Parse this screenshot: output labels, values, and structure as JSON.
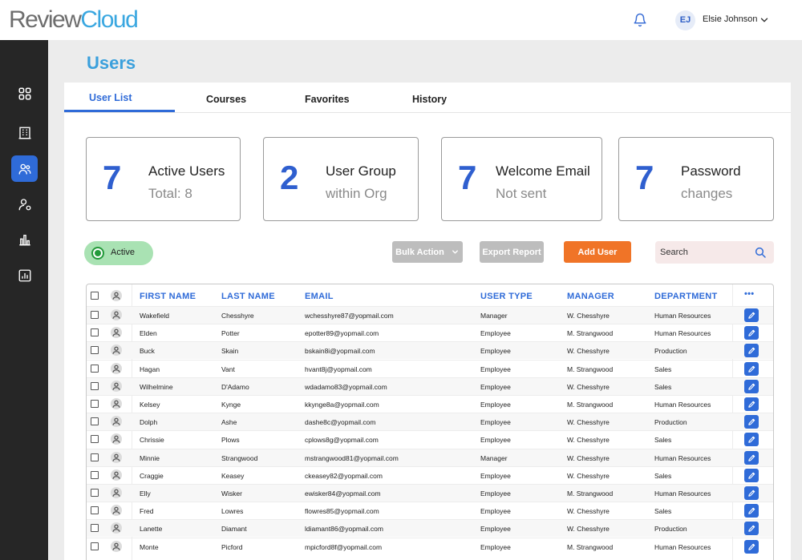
{
  "app": {
    "logo_part1": "Review",
    "logo_part2": "Cloud",
    "user_initials": "EJ",
    "user_name": "Elsie Johnson"
  },
  "colors": {
    "accent": "#2f6bd8",
    "title": "#3ba0dc",
    "add_button": "#f07427",
    "active_green": "#239a3a",
    "sidebar": "#262626"
  },
  "sidebar": {
    "items": [
      {
        "icon": "dashboard-grid-icon",
        "active": false
      },
      {
        "icon": "building-icon",
        "active": false
      },
      {
        "icon": "users-icon",
        "active": true
      },
      {
        "icon": "user-settings-icon",
        "active": false
      },
      {
        "icon": "bar-chart-icon",
        "active": false
      },
      {
        "icon": "report-chart-icon",
        "active": false
      }
    ]
  },
  "page": {
    "title": "Users"
  },
  "tabs": [
    {
      "label": "User List",
      "active": true
    },
    {
      "label": "Courses",
      "active": false
    },
    {
      "label": "Favorites",
      "active": false
    },
    {
      "label": "History",
      "active": false
    }
  ],
  "stats": [
    {
      "number": "7",
      "label": "Active Users",
      "sub": "Total:  8"
    },
    {
      "number": "2",
      "label": "User Group",
      "sub": "within Org"
    },
    {
      "number": "7",
      "label": "Welcome Email",
      "sub": "Not sent"
    },
    {
      "number": "7",
      "label": "Password",
      "sub": "changes"
    }
  ],
  "toolbar": {
    "status_filter": "Active",
    "bulk_action": "Bulk Action",
    "export_report": "Export Report",
    "add_user": "Add User",
    "search_placeholder": "Search"
  },
  "table": {
    "columns": [
      "FIRST NAME",
      "LAST NAME",
      "EMAIL",
      "USER TYPE",
      "MANAGER",
      "DEPARTMENT"
    ],
    "more_label": "•••",
    "rows": [
      {
        "first": "Wakefield",
        "last": "Chesshyre",
        "email": "wchesshyre87@yopmail.com",
        "type": "Manager",
        "manager": "W. Chesshyre",
        "dept": "Human Resources"
      },
      {
        "first": "Elden",
        "last": "Potter",
        "email": "epotter89@yopmail.com",
        "type": "Employee",
        "manager": "M. Strangwood",
        "dept": "Human Resources"
      },
      {
        "first": "Buck",
        "last": "Skain",
        "email": "bskain8i@yopmail.com",
        "type": "Employee",
        "manager": "W. Chesshyre",
        "dept": "Production"
      },
      {
        "first": "Hagan",
        "last": "Vant",
        "email": "hvant8j@yopmail.com",
        "type": "Employee",
        "manager": "M. Strangwood",
        "dept": "Sales"
      },
      {
        "first": "Wilhelmine",
        "last": "D'Adamo",
        "email": "wdadamo83@yopmail.com",
        "type": "Employee",
        "manager": "W. Chesshyre",
        "dept": "Sales"
      },
      {
        "first": "Kelsey",
        "last": "Kynge",
        "email": "kkynge8a@yopmail.com",
        "type": "Employee",
        "manager": "M. Strangwood",
        "dept": "Human Resources"
      },
      {
        "first": "Dolph",
        "last": "Ashe",
        "email": "dashe8c@yopmail.com",
        "type": "Employee",
        "manager": "W. Chesshyre",
        "dept": "Production"
      },
      {
        "first": "Chrissie",
        "last": "Plows",
        "email": "cplows8g@yopmail.com",
        "type": "Employee",
        "manager": "W. Chesshyre",
        "dept": "Sales"
      },
      {
        "first": "Minnie",
        "last": "Strangwood",
        "email": "mstrangwood81@yopmail.com",
        "type": "Manager",
        "manager": "W. Chesshyre",
        "dept": "Human Resources"
      },
      {
        "first": "Craggie",
        "last": "Keasey",
        "email": "ckeasey82@yopmail.com",
        "type": "Employee",
        "manager": "W. Chesshyre",
        "dept": "Sales"
      },
      {
        "first": "Elly",
        "last": "Wisker",
        "email": "ewisker84@yopmail.com",
        "type": "Employee",
        "manager": "M. Strangwood",
        "dept": "Human Resources"
      },
      {
        "first": "Fred",
        "last": "Lowres",
        "email": "flowres85@yopmail.com",
        "type": "Employee",
        "manager": "W. Chesshyre",
        "dept": "Sales"
      },
      {
        "first": "Lanette",
        "last": "Diamant",
        "email": "ldiamant86@yopmail.com",
        "type": "Employee",
        "manager": "W. Chesshyre",
        "dept": "Production"
      },
      {
        "first": "Monte",
        "last": "Picford",
        "email": "mpicford8f@yopmail.com",
        "type": "Employee",
        "manager": "M. Strangwood",
        "dept": "Human Resources"
      }
    ]
  }
}
